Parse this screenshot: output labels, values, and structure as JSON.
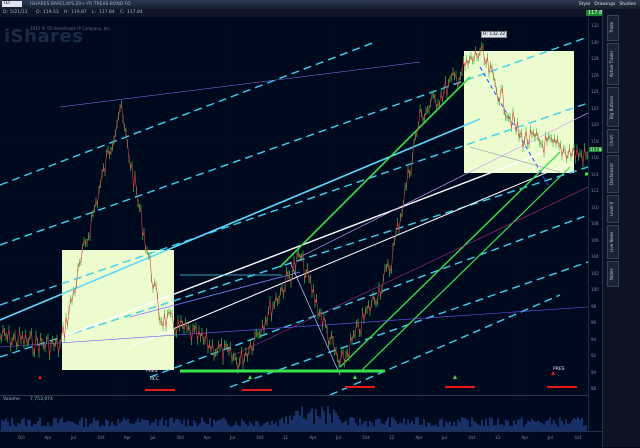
{
  "topbar": {
    "symbol": "TLT",
    "description": "ISHARES BARCLAYS 20+ YR TREAS BOND FD",
    "tools": [
      "Style",
      "Drawings",
      "Studies"
    ]
  },
  "quotebar": {
    "fields": [
      "D:",
      "5/21/13",
      "O:",
      "119.53",
      "H:",
      "119.87",
      "L:",
      "117.84",
      "C:",
      "117.84"
    ],
    "price": "117.84"
  },
  "chart": {
    "watermark": "iShares",
    "source": "2013 ® TD Ameritrade IP Company, Inc.",
    "high_label": "H: 132.22",
    "pres_labels": [
      "PRES",
      "RCC"
    ],
    "pres_label_right": "PRES",
    "right_ticks": [
      "132",
      "130",
      "128",
      "126",
      "124",
      "122",
      "120",
      "118",
      "116",
      "114",
      "112",
      "110",
      "108",
      "106",
      "104",
      "102",
      "100",
      "98",
      "96",
      "94",
      "92",
      "90",
      "88"
    ],
    "price_tag": "117.84"
  },
  "volume": {
    "label": "Volume",
    "value": "7,753,074"
  },
  "bottom_axis": {
    "ticks": [
      "Oct",
      "Apr",
      "Jul",
      "Oct",
      "Apr",
      "Jul",
      "Oct",
      "Apr",
      "Jul",
      "Oct",
      "11",
      "Apr",
      "Jul",
      "Oct",
      "12",
      "Apr",
      "Jul",
      "Oct",
      "13",
      "Apr",
      "Jul",
      "Oct"
    ]
  },
  "side_tabs": [
    "Trade",
    "Active Trader",
    "Big Buttons",
    "Chart",
    "Dashboard",
    "Level II",
    "Live News",
    "Notes"
  ],
  "colors": {
    "bg": "#000a1f",
    "box": "#ecfccf",
    "trend_cyan": "#3fd0f0",
    "trend_green": "#39e24a",
    "marker_red": "#e81818"
  }
}
